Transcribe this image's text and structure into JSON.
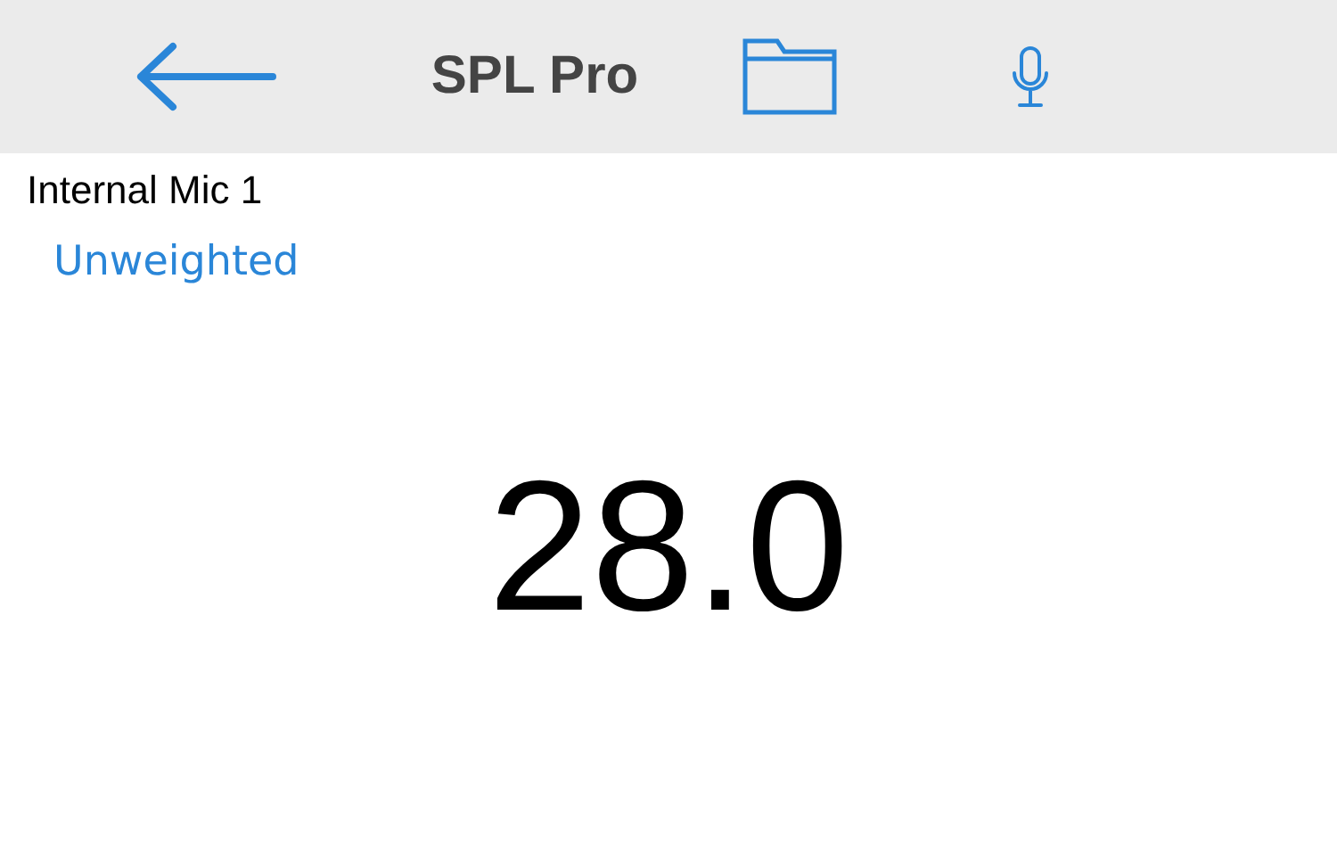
{
  "header": {
    "title": "SPL Pro"
  },
  "device": "Internal Mic 1",
  "weighting": "Unweighted",
  "reading": "28.0"
}
